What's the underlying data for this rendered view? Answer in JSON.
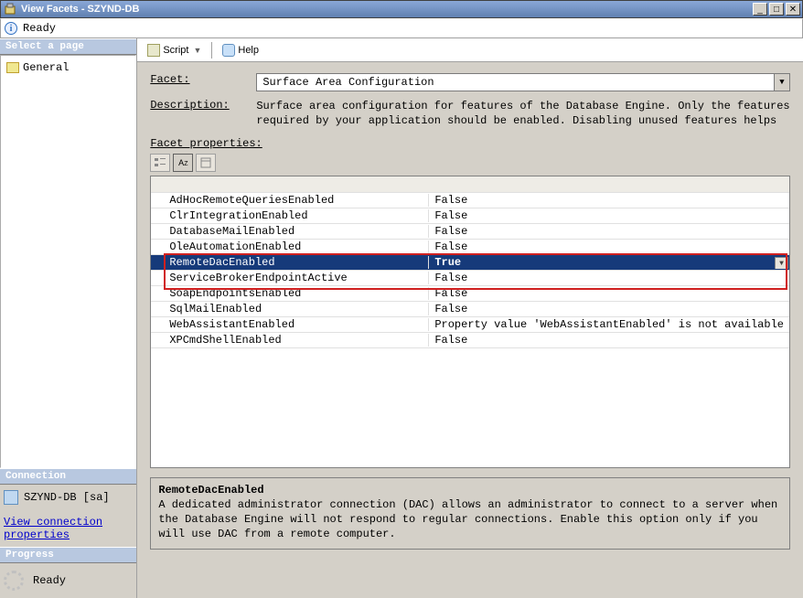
{
  "window": {
    "title": "View Facets - SZYND-DB"
  },
  "status": {
    "text": "Ready"
  },
  "left": {
    "select_title": "Select a page",
    "general": "General",
    "connection_title": "Connection",
    "server": "SZYND-DB [sa]",
    "view_conn_link": "View connection properties",
    "progress_title": "Progress",
    "progress_text": "Ready"
  },
  "toolbar": {
    "script": "Script",
    "help": "Help"
  },
  "form": {
    "facet_label": "Facet:",
    "facet_value": "Surface Area Configuration",
    "description_label": "Description:",
    "description_text": "Surface area configuration for features of the Database Engine. Only the features required by your application should be enabled. Disabling unused features helps",
    "props_label": "Facet properties:"
  },
  "props": [
    {
      "name": "AdHocRemoteQueriesEnabled",
      "value": "False"
    },
    {
      "name": "ClrIntegrationEnabled",
      "value": "False"
    },
    {
      "name": "DatabaseMailEnabled",
      "value": "False"
    },
    {
      "name": "OleAutomationEnabled",
      "value": "False"
    },
    {
      "name": "RemoteDacEnabled",
      "value": "True"
    },
    {
      "name": "ServiceBrokerEndpointActive",
      "value": "False"
    },
    {
      "name": "SoapEndpointsEnabled",
      "value": "False"
    },
    {
      "name": "SqlMailEnabled",
      "value": "False"
    },
    {
      "name": "WebAssistantEnabled",
      "value": "Property value 'WebAssistantEnabled' is not available"
    },
    {
      "name": "XPCmdShellEnabled",
      "value": "False"
    }
  ],
  "selected_index": 4,
  "help": {
    "name": "RemoteDacEnabled",
    "desc": "A dedicated administrator connection (DAC) allows an administrator to connect to a server when the Database Engine will not respond to regular connections. Enable this option only if you will use DAC from a remote computer."
  }
}
